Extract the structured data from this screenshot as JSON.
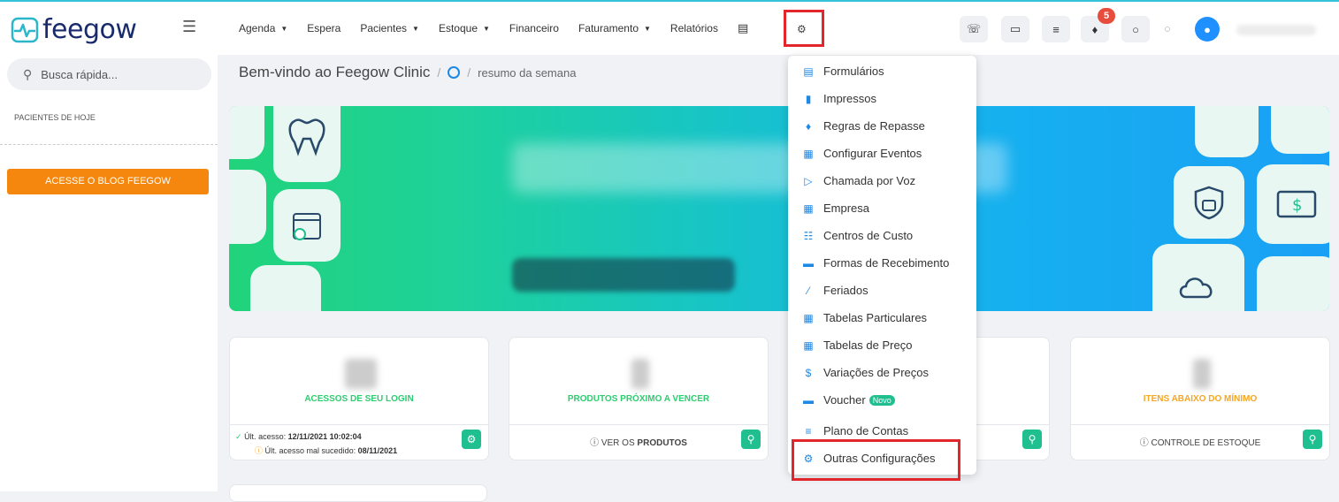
{
  "brand": {
    "name": "feegow"
  },
  "nav": {
    "items": [
      {
        "label": "Agenda",
        "dropdown": true
      },
      {
        "label": "Espera",
        "dropdown": false
      },
      {
        "label": "Pacientes",
        "dropdown": true
      },
      {
        "label": "Estoque",
        "dropdown": true
      },
      {
        "label": "Financeiro",
        "dropdown": false
      },
      {
        "label": "Faturamento",
        "dropdown": true
      },
      {
        "label": "Relatórios",
        "dropdown": false
      }
    ]
  },
  "top": {
    "notifications_count": "5"
  },
  "sidebar": {
    "search_placeholder": "Busca rápida...",
    "patients_today": "PACIENTES DE HOJE",
    "blog_button": "ACESSE O BLOG FEEGOW"
  },
  "breadcrumb": {
    "title": "Bem-vindo ao Feegow Clinic",
    "sub": "resumo da semana"
  },
  "cards": [
    {
      "title": "ACESSOS DE SEU LOGIN",
      "title_color": "#2ecc71",
      "last_access_label": "Últ. acesso: ",
      "last_access": "12/11/2021 10:02:04",
      "fail_label": "Últ. acesso mal sucedido: ",
      "fail": "08/11/2021"
    },
    {
      "title": "PRODUTOS PRÓXIMO A VENCER",
      "title_color": "#2ecc71",
      "footer_prefix": "VER OS ",
      "footer_bold": "PRODUTOS"
    },
    {
      "title": "ITENS ABAIXO DO MÍNIMO",
      "title_color": "#f5a623",
      "footer": "CONTROLE DE ESTOQUE"
    }
  ],
  "menu": {
    "items": [
      {
        "label": "Formulários",
        "icon": "chart-icon"
      },
      {
        "label": "Impressos",
        "icon": "file-icon"
      },
      {
        "label": "Regras de Repasse",
        "icon": "handshake-icon"
      },
      {
        "label": "Configurar Eventos",
        "icon": "calendar-icon"
      },
      {
        "label": "Chamada por Voz",
        "icon": "speaker-icon"
      },
      {
        "label": "Empresa",
        "icon": "building-icon"
      },
      {
        "label": "Centros de Custo",
        "icon": "sitemap-icon"
      },
      {
        "label": "Formas de Recebimento",
        "icon": "card-icon"
      },
      {
        "label": "Feriados",
        "icon": "road-icon"
      },
      {
        "label": "Tabelas Particulares",
        "icon": "table-icon"
      },
      {
        "label": "Tabelas de Preço",
        "icon": "table-icon"
      },
      {
        "label": "Variações de Preços",
        "icon": "dollar-icon"
      },
      {
        "label": "Voucher",
        "icon": "ticket-icon",
        "badge": "Novo"
      },
      {
        "label": "Plano de Contas",
        "icon": "list-icon"
      },
      {
        "label": "Outras Configurações",
        "icon": "gears-icon"
      }
    ]
  }
}
